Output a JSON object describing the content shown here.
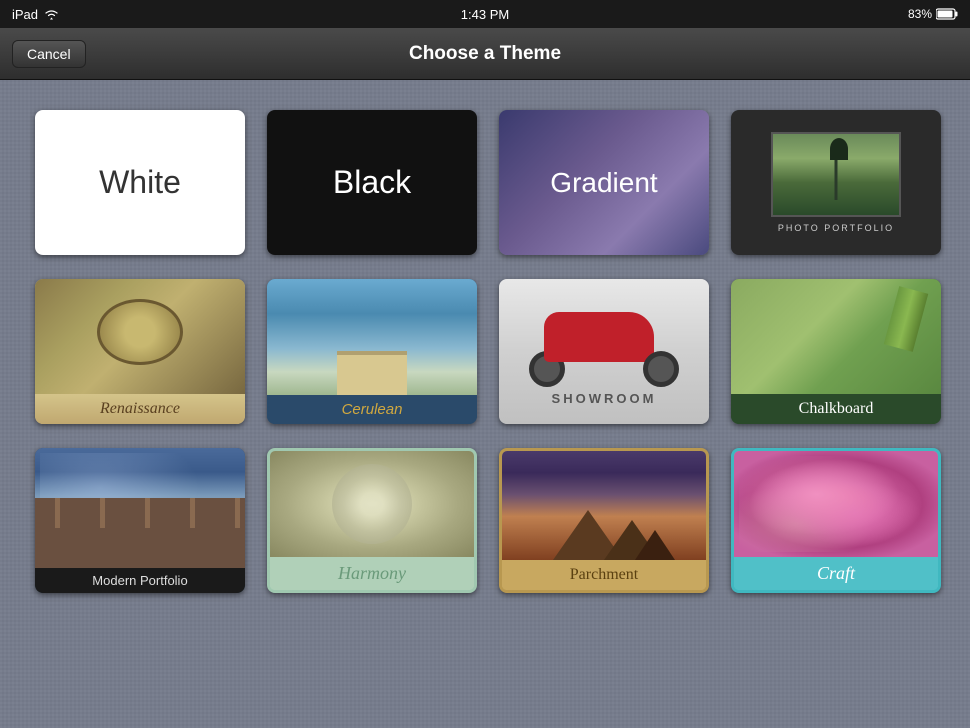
{
  "statusBar": {
    "device": "iPad",
    "time": "1:43 PM",
    "battery": "83%",
    "wifi": true
  },
  "navBar": {
    "title": "Choose a Theme",
    "cancelLabel": "Cancel"
  },
  "themes": {
    "row1": [
      {
        "id": "white",
        "label": "White",
        "type": "white"
      },
      {
        "id": "black",
        "label": "Black",
        "type": "black"
      },
      {
        "id": "gradient",
        "label": "Gradient",
        "type": "gradient"
      },
      {
        "id": "photo-portfolio",
        "label": "PHOTO PORTFOLIO",
        "type": "photo-portfolio"
      }
    ],
    "row2": [
      {
        "id": "renaissance",
        "label": "Renaissance",
        "type": "renaissance"
      },
      {
        "id": "cerulean",
        "label": "Cerulean",
        "type": "cerulean"
      },
      {
        "id": "showroom",
        "label": "SHOWROOM",
        "type": "showroom"
      },
      {
        "id": "chalkboard",
        "label": "Chalkboard",
        "type": "chalkboard"
      }
    ],
    "row3": [
      {
        "id": "modern-portfolio",
        "label": "Modern Portfolio",
        "type": "modern-portfolio"
      },
      {
        "id": "harmony",
        "label": "Harmony",
        "type": "harmony"
      },
      {
        "id": "parchment",
        "label": "Parchment",
        "type": "parchment"
      },
      {
        "id": "craft",
        "label": "Craft",
        "type": "craft"
      }
    ]
  }
}
